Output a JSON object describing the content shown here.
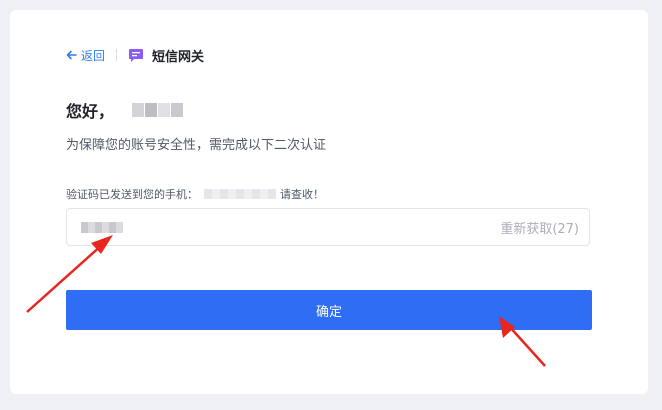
{
  "header": {
    "back_label": "返回",
    "title": "短信网关",
    "back_icon": "arrow-left-icon",
    "title_icon": "message-icon"
  },
  "greeting": {
    "text": "您好，"
  },
  "subtitle": "为保障您的账号安全性，需完成以下二次认证",
  "code_notice": {
    "prefix": "验证码已发送到您的手机：",
    "suffix": "请查收！"
  },
  "code_input": {
    "resend_label": "重新获取(27)"
  },
  "confirm_button": {
    "label": "确定"
  },
  "colors": {
    "accent": "#2f7cf6",
    "button": "#2f6df5",
    "title_icon": "#8a5cf6",
    "annotation_arrow": "#e8251f"
  }
}
